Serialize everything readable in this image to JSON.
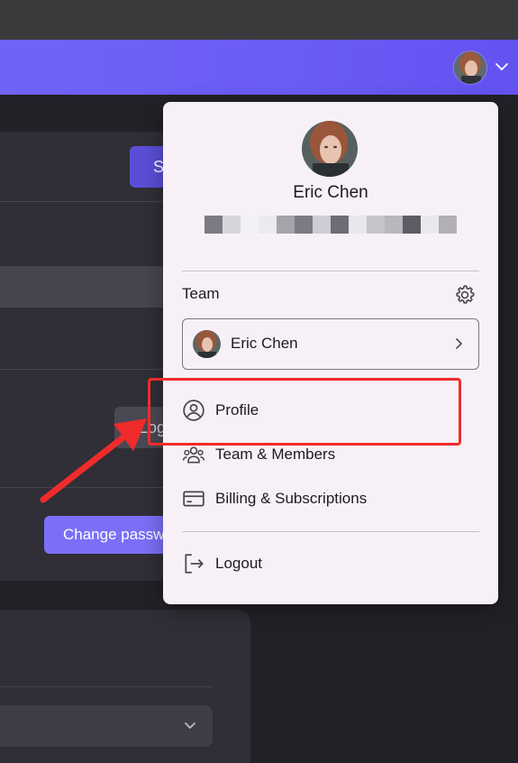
{
  "header": {
    "avatar_icon": "user-avatar-photo",
    "chevron_icon": "chevron-down-icon"
  },
  "background": {
    "save_button_label": "S",
    "logout_button_label": "Log",
    "change_password_label": "Change passw"
  },
  "menu": {
    "user_name": "Eric Chen",
    "email": "redacted",
    "team_label": "Team",
    "team_settings_icon": "gear-icon",
    "current_team": "Eric Chen",
    "items": [
      {
        "label": "Profile",
        "icon": "user-circle-icon"
      },
      {
        "label": "Team & Members",
        "icon": "users-icon"
      },
      {
        "label": "Billing & Subscriptions",
        "icon": "credit-card-icon"
      },
      {
        "label": "Logout",
        "icon": "logout-icon"
      }
    ]
  },
  "colors": {
    "accent": "#6a5cf6",
    "annotation": "#ef2b2b",
    "menu_bg": "#f7f1f7"
  }
}
